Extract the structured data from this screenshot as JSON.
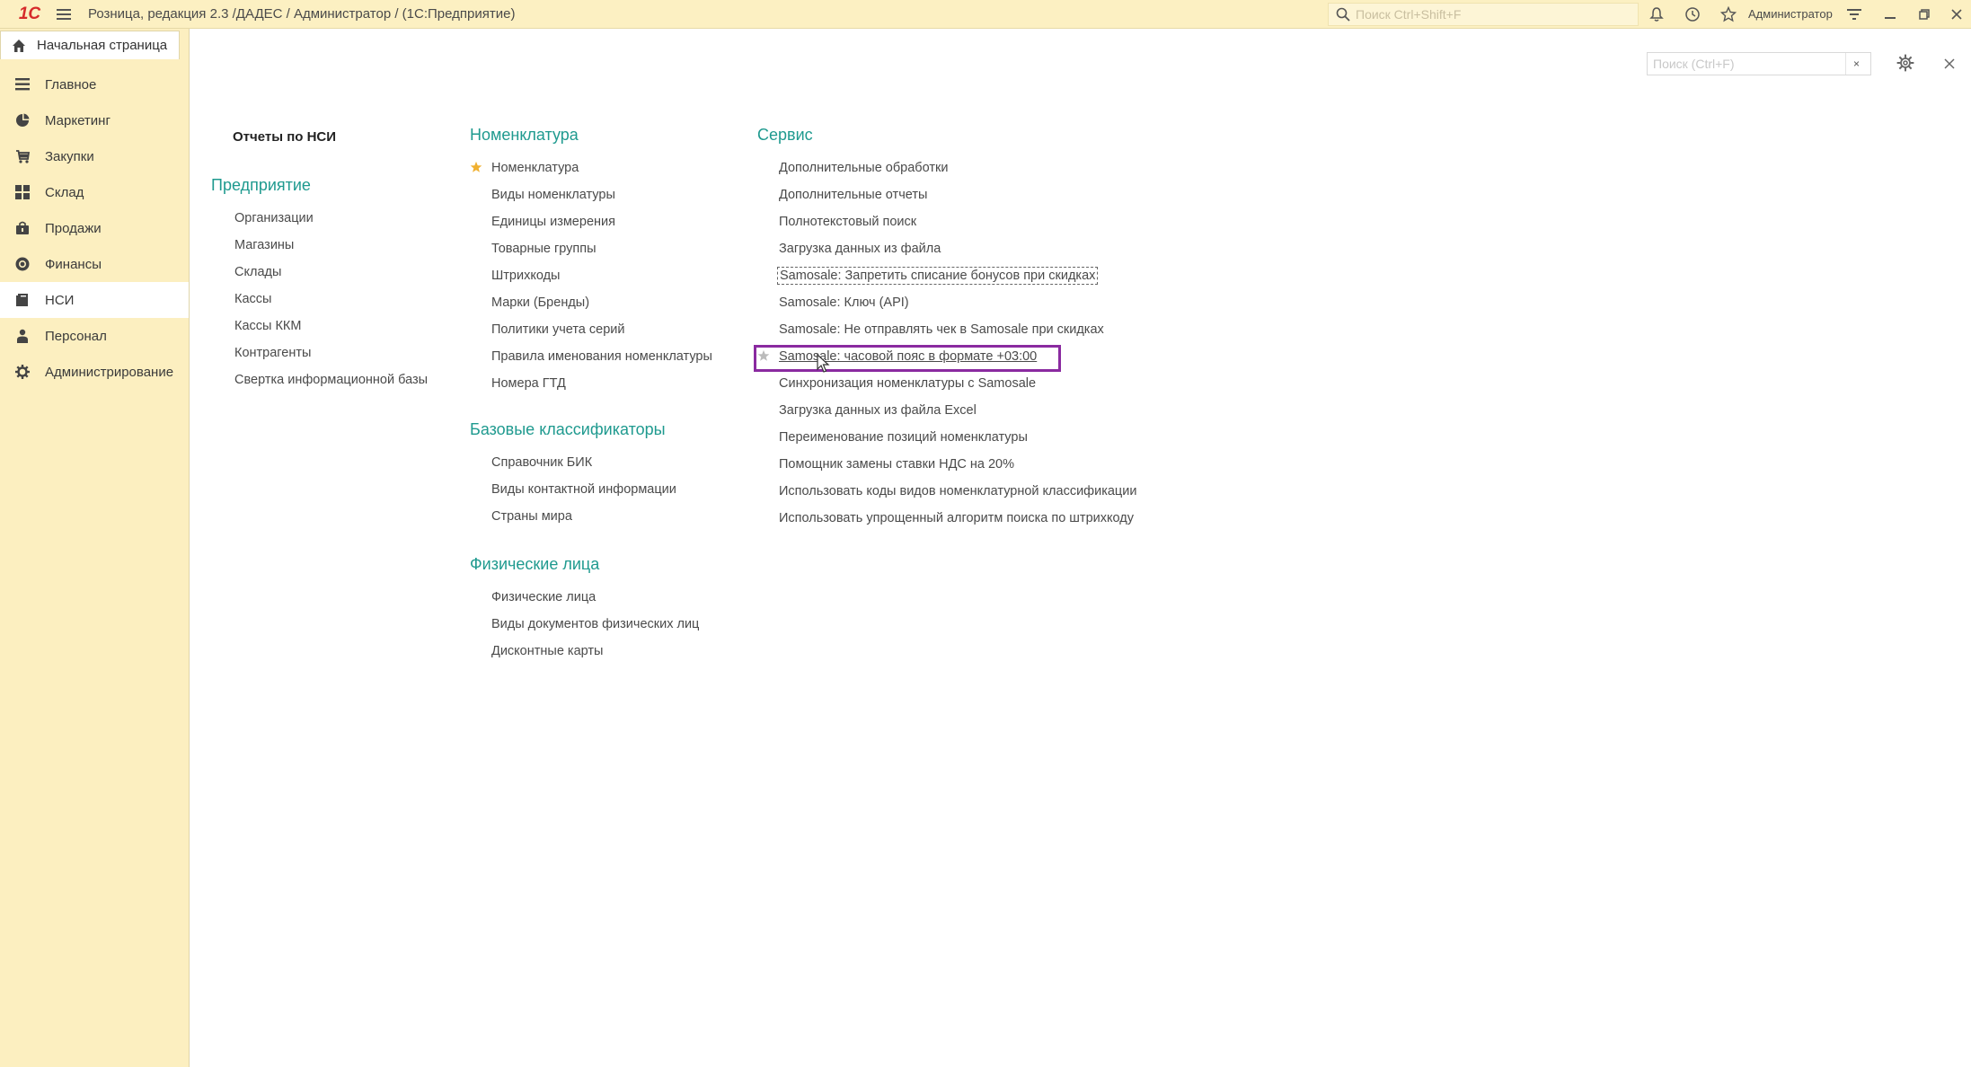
{
  "window": {
    "title": "Розница, редакция 2.3 /ДАДЕС / Администратор /  (1С:Предприятие)",
    "logo": "1С",
    "user": "Администратор"
  },
  "global_search": {
    "placeholder": "Поиск Ctrl+Shift+F"
  },
  "sidebar": {
    "home_tab": "Начальная страница",
    "items": [
      {
        "label": "Главное",
        "icon": "list-icon"
      },
      {
        "label": "Маркетинг",
        "icon": "pie-chart-icon"
      },
      {
        "label": "Закупки",
        "icon": "cart-icon"
      },
      {
        "label": "Склад",
        "icon": "grid-icon"
      },
      {
        "label": "Продажи",
        "icon": "bag-icon"
      },
      {
        "label": "Финансы",
        "icon": "coin-icon"
      },
      {
        "label": "НСИ",
        "icon": "book-icon",
        "active": true
      },
      {
        "label": "Персонал",
        "icon": "person-icon"
      },
      {
        "label": "Администрирование",
        "icon": "gear-icon"
      }
    ]
  },
  "panel": {
    "search_placeholder": "Поиск (Ctrl+F)",
    "clear_label": "×",
    "reports": "Отчеты по НСИ",
    "enterprise": {
      "title": "Предприятие",
      "items": [
        "Организации",
        "Магазины",
        "Склады",
        "Кассы",
        "Кассы ККМ",
        "Контрагенты",
        "Свертка информационной базы"
      ]
    },
    "nomenclature": {
      "title": "Номенклатура",
      "items": [
        "Номенклатура",
        "Виды номенклатуры",
        "Единицы измерения",
        "Товарные группы",
        "Штрихкоды",
        "Марки (Бренды)",
        "Политики учета серий",
        "Правила именования номенклатуры",
        "Номера ГТД"
      ]
    },
    "classifiers": {
      "title": "Базовые классификаторы",
      "items": [
        "Справочник БИК",
        "Виды контактной информации",
        "Страны мира"
      ]
    },
    "persons": {
      "title": "Физические лица",
      "items": [
        "Физические лица",
        "Виды документов физических лиц",
        "Дисконтные карты"
      ]
    },
    "service": {
      "title": "Сервис",
      "items": [
        "Дополнительные обработки",
        "Дополнительные отчеты",
        "Полнотекстовый поиск",
        "Загрузка данных из файла",
        "Samosale: Запретить списание бонусов при скидках",
        "Samosale: Ключ (API)",
        "Samosale: Не отправлять чек в Samosale при скидках",
        "Samosale: часовой пояс в формате +03:00",
        "Синхронизация номенклатуры с Samosale",
        "Загрузка данных из файла Excel",
        "Переименование позиций номенклатуры",
        "Помощник замены ставки НДС на 20%",
        "Использовать коды видов номенклатурной классификации",
        "Использовать упрощенный алгоритм поиска по штрихкоду"
      ]
    }
  }
}
